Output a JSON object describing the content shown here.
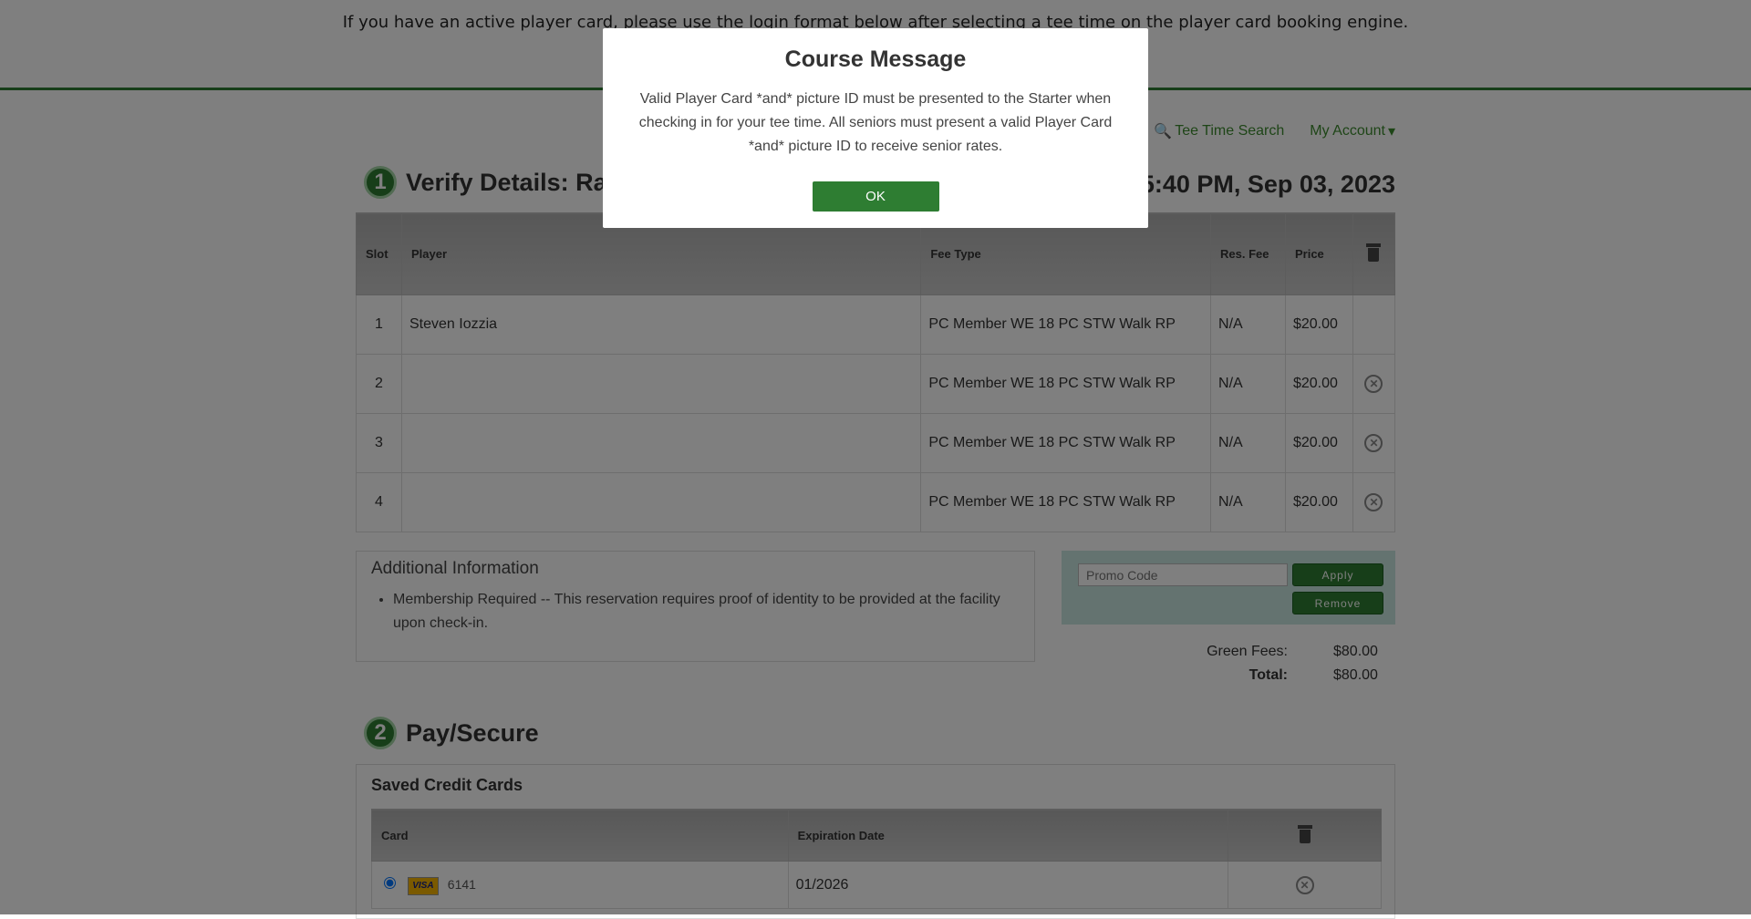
{
  "banner": {
    "notice": "If you have an active player card, please use the login format below after selecting a tee time on the player card booking engine."
  },
  "nav": {
    "tee_time_search": "Tee Time Search",
    "my_account": "My Account"
  },
  "verify": {
    "step_number": "1",
    "title": "Verify Details: Ran",
    "datetime": "5:40 PM, Sep 03, 2023",
    "columns": {
      "slot": "Slot",
      "player": "Player",
      "fee_type": "Fee Type",
      "res_fee": "Res. Fee",
      "price": "Price"
    },
    "rows": [
      {
        "slot": "1",
        "player": "Steven Iozzia",
        "fee_type": "PC Member WE 18 PC STW Walk RP",
        "res_fee": "N/A",
        "price": "$20.00"
      },
      {
        "slot": "2",
        "player": "",
        "fee_type": "PC Member WE 18 PC STW Walk RP",
        "res_fee": "N/A",
        "price": "$20.00"
      },
      {
        "slot": "3",
        "player": "",
        "fee_type": "PC Member WE 18 PC STW Walk RP",
        "res_fee": "N/A",
        "price": "$20.00"
      },
      {
        "slot": "4",
        "player": "",
        "fee_type": "PC Member WE 18 PC STW Walk RP",
        "res_fee": "N/A",
        "price": "$20.00"
      }
    ]
  },
  "additional_info": {
    "title": "Additional Information",
    "items": [
      "Membership Required -- This reservation requires proof of identity to be provided at the facility upon check-in."
    ]
  },
  "promo": {
    "placeholder": "Promo Code",
    "apply_label": "Apply",
    "remove_label": "Remove"
  },
  "summary": {
    "green_fees_label": "Green Fees:",
    "green_fees_value": "$80.00",
    "total_label": "Total:",
    "total_value": "$80.00"
  },
  "pay": {
    "step_number": "2",
    "title": "Pay/Secure",
    "saved_cards_title": "Saved Credit Cards",
    "columns": {
      "card": "Card",
      "expiration": "Expiration Date"
    },
    "cards": [
      {
        "brand": "VISA",
        "last4": "6141",
        "expiration": "01/2026"
      }
    ]
  },
  "modal": {
    "title": "Course Message",
    "message": "Valid Player Card *and* picture ID must be presented to the Starter when checking in for your tee time. All seniors must present a valid Player Card *and* picture ID to receive senior rates.",
    "ok_label": "OK"
  },
  "colors": {
    "accent_green": "#2e7d32",
    "link_green": "#3d8b2e",
    "promo_bg": "#c8e6e0"
  }
}
